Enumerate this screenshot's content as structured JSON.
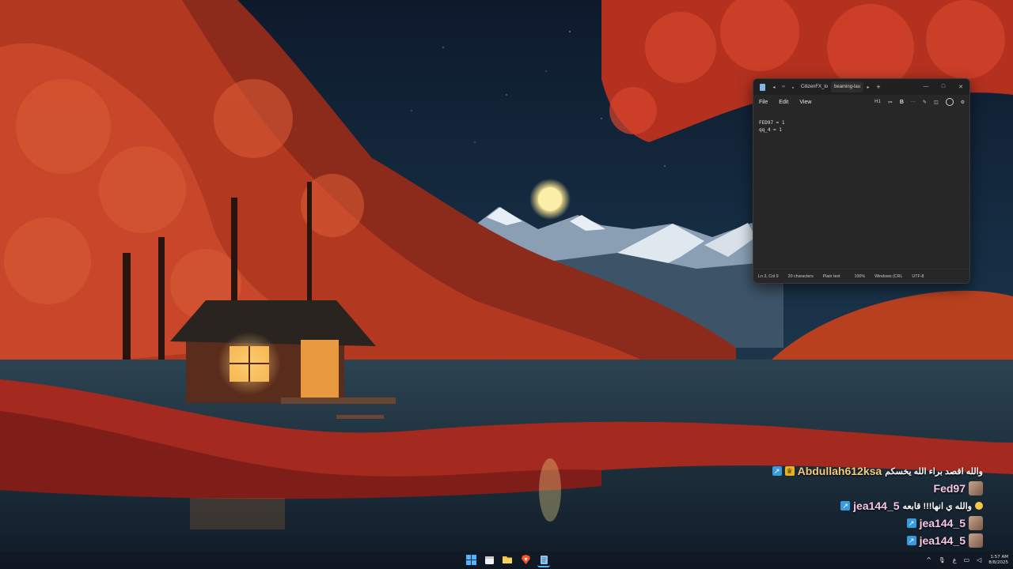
{
  "notepad": {
    "tabs": [
      {
        "label": "CitizenFX_lo"
      },
      {
        "label": "beaming-lau"
      }
    ],
    "nav": {
      "back": "◂",
      "jump": "‹‹",
      "dot": "●",
      "forward": "▸",
      "new_tab": "+"
    },
    "window_controls": {
      "minimize": "—",
      "maximize": "□",
      "close": "✕"
    },
    "menu": {
      "file": "File",
      "edit": "Edit",
      "view": "View"
    },
    "toolbar": {
      "heading": "H1",
      "list": "≔",
      "bold": "B",
      "more": "···",
      "format": "✎",
      "brush": "◫"
    },
    "content_lines": [
      "FED97 = 1",
      "qq_4 = 1"
    ],
    "status": {
      "position": "Ln 3, Col 9",
      "characters": "20 characters",
      "format": "Plain text",
      "zoom": "100%",
      "line_ending": "Windows (CRL",
      "encoding": "UTF-8"
    }
  },
  "chat": [
    {
      "username": "Abdullah612ksa",
      "message": "والله اقصد براء الله يخسكم",
      "badges": [
        "arrow",
        "crown"
      ]
    },
    {
      "username": "Fed97",
      "message": "",
      "badges": []
    },
    {
      "username": "jea144_5",
      "message": "والله ي انها!!! قابعه",
      "badges": [
        "arrow"
      ]
    },
    {
      "username": "jea144_5",
      "message": "",
      "badges": [
        "arrow"
      ]
    },
    {
      "username": "jea144_5",
      "message": "",
      "badges": [
        "arrow"
      ]
    }
  ],
  "taskbar": {
    "apps": [
      "start",
      "calendar",
      "file-explorer",
      "brave-browser",
      "notepad"
    ],
    "tray": {
      "chevron": "^",
      "mic": "🎙",
      "lang": "ع",
      "time": "1:57 AM",
      "date": "8/8/2025"
    }
  },
  "colors": {
    "accent": "#4ab7ff",
    "notepad_bg": "#272727",
    "chat_name": "#f7c6e4"
  }
}
